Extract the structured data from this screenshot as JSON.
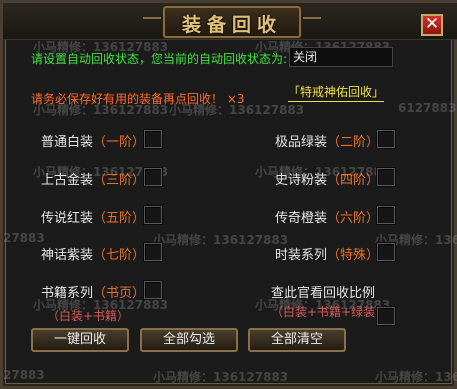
{
  "window": {
    "title": "装备回收",
    "close_label": "✕"
  },
  "status": {
    "prompt": "请设置自动回收状态，您当前的自动回收状态为:",
    "value": "关闭"
  },
  "notice": {
    "text": "请务必保存好有用的装备再点回收！ ×3"
  },
  "special_link": {
    "label": "「特戒神佑回收」"
  },
  "options": [
    {
      "name": "普通白装",
      "tier": "（一阶）"
    },
    {
      "name": "极品绿装",
      "tier": "（二阶）"
    },
    {
      "name": "上古金装",
      "tier": "（三阶）"
    },
    {
      "name": "史诗粉装",
      "tier": "（四阶）"
    },
    {
      "name": "传说红装",
      "tier": "（五阶）"
    },
    {
      "name": "传奇橙装",
      "tier": "（六阶）"
    },
    {
      "name": "神话紫装",
      "tier": "（七阶）"
    },
    {
      "name": "时装系列",
      "tier": "（特殊）"
    },
    {
      "name": "书籍系列",
      "tier": "（书页）",
      "note": "（白装+书籍）"
    },
    {
      "name": "查此官看回收比例",
      "note": "（白装+书籍+绿装）"
    }
  ],
  "buttons": {
    "one_click_recycle": "一键回收",
    "select_all": "全部勾选",
    "clear_all": "全部清空"
  },
  "watermark": {
    "text": "小马精修：136127883",
    "fragments": [
      "27883",
      "6127883",
      "883",
      "3"
    ]
  }
}
